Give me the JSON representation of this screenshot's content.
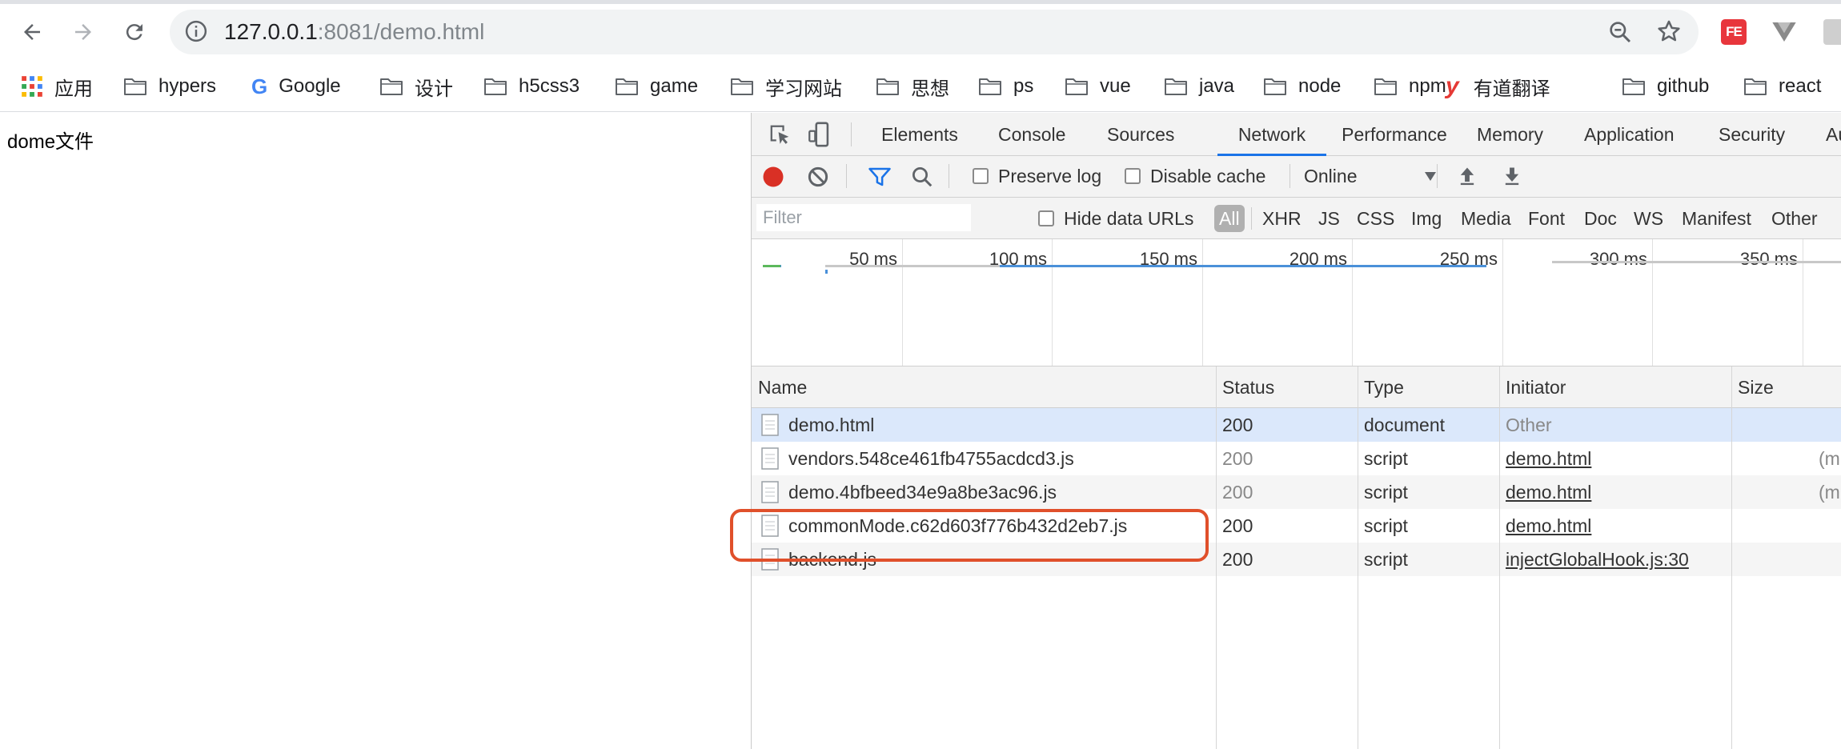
{
  "browser": {
    "url_host": "127.0.0.1",
    "url_rest": ":8081/demo.html",
    "extension_fe_label": "FE"
  },
  "bookmarks": [
    {
      "label": "应用",
      "icon": "apps-grid-icon"
    },
    {
      "label": "hypers",
      "icon": "folder-icon"
    },
    {
      "label": "Google",
      "icon": "google-icon"
    },
    {
      "label": "设计",
      "icon": "folder-icon"
    },
    {
      "label": "h5css3",
      "icon": "folder-icon"
    },
    {
      "label": "game",
      "icon": "folder-icon"
    },
    {
      "label": "学习网站",
      "icon": "folder-icon"
    },
    {
      "label": "思想",
      "icon": "folder-icon"
    },
    {
      "label": "ps",
      "icon": "folder-icon"
    },
    {
      "label": "vue",
      "icon": "folder-icon"
    },
    {
      "label": "java",
      "icon": "folder-icon"
    },
    {
      "label": "node",
      "icon": "folder-icon"
    },
    {
      "label": "npm",
      "icon": "folder-icon"
    },
    {
      "label": "有道翻译",
      "icon": "youdao-icon"
    },
    {
      "label": "github",
      "icon": "folder-icon"
    },
    {
      "label": "react",
      "icon": "folder-icon"
    }
  ],
  "page": {
    "text": "dome文件"
  },
  "devtools": {
    "tabs": [
      "Elements",
      "Console",
      "Sources",
      "Network",
      "Performance",
      "Memory",
      "Application",
      "Security",
      "Audits"
    ],
    "active_tab": "Network",
    "toolbar": {
      "preserve_log": "Preserve log",
      "disable_cache": "Disable cache",
      "throttle": "Online"
    },
    "filter": {
      "placeholder": "Filter",
      "hide_data_urls": "Hide data URLs",
      "types": [
        "All",
        "XHR",
        "JS",
        "CSS",
        "Img",
        "Media",
        "Font",
        "Doc",
        "WS",
        "Manifest",
        "Other"
      ],
      "active_type": "All"
    },
    "overview_ticks": [
      "50 ms",
      "100 ms",
      "150 ms",
      "200 ms",
      "250 ms",
      "300 ms",
      "350 ms"
    ],
    "columns": [
      "Name",
      "Status",
      "Type",
      "Initiator",
      "Size"
    ],
    "rows": [
      {
        "name": "demo.html",
        "status": "200",
        "type": "document",
        "initiator": "Other",
        "size": ""
      },
      {
        "name": "vendors.548ce461fb4755acdcd3.js",
        "status": "200",
        "type": "script",
        "initiator": "demo.html",
        "size": "(m"
      },
      {
        "name": "demo.4bfbeed34e9a8be3ac96.js",
        "status": "200",
        "type": "script",
        "initiator": "demo.html",
        "size": "(m"
      },
      {
        "name": "commonMode.c62d603f776b432d2eb7.js",
        "status": "200",
        "type": "script",
        "initiator": "demo.html",
        "size": ""
      },
      {
        "name": "backend.js",
        "status": "200",
        "type": "script",
        "initiator": "injectGlobalHook.js:30",
        "size": ""
      }
    ]
  },
  "colors": {
    "accent_blue": "#1a73e8",
    "record_red": "#d93025",
    "selected_row": "#dbe8fb",
    "highlight_box": "#e0502b"
  }
}
